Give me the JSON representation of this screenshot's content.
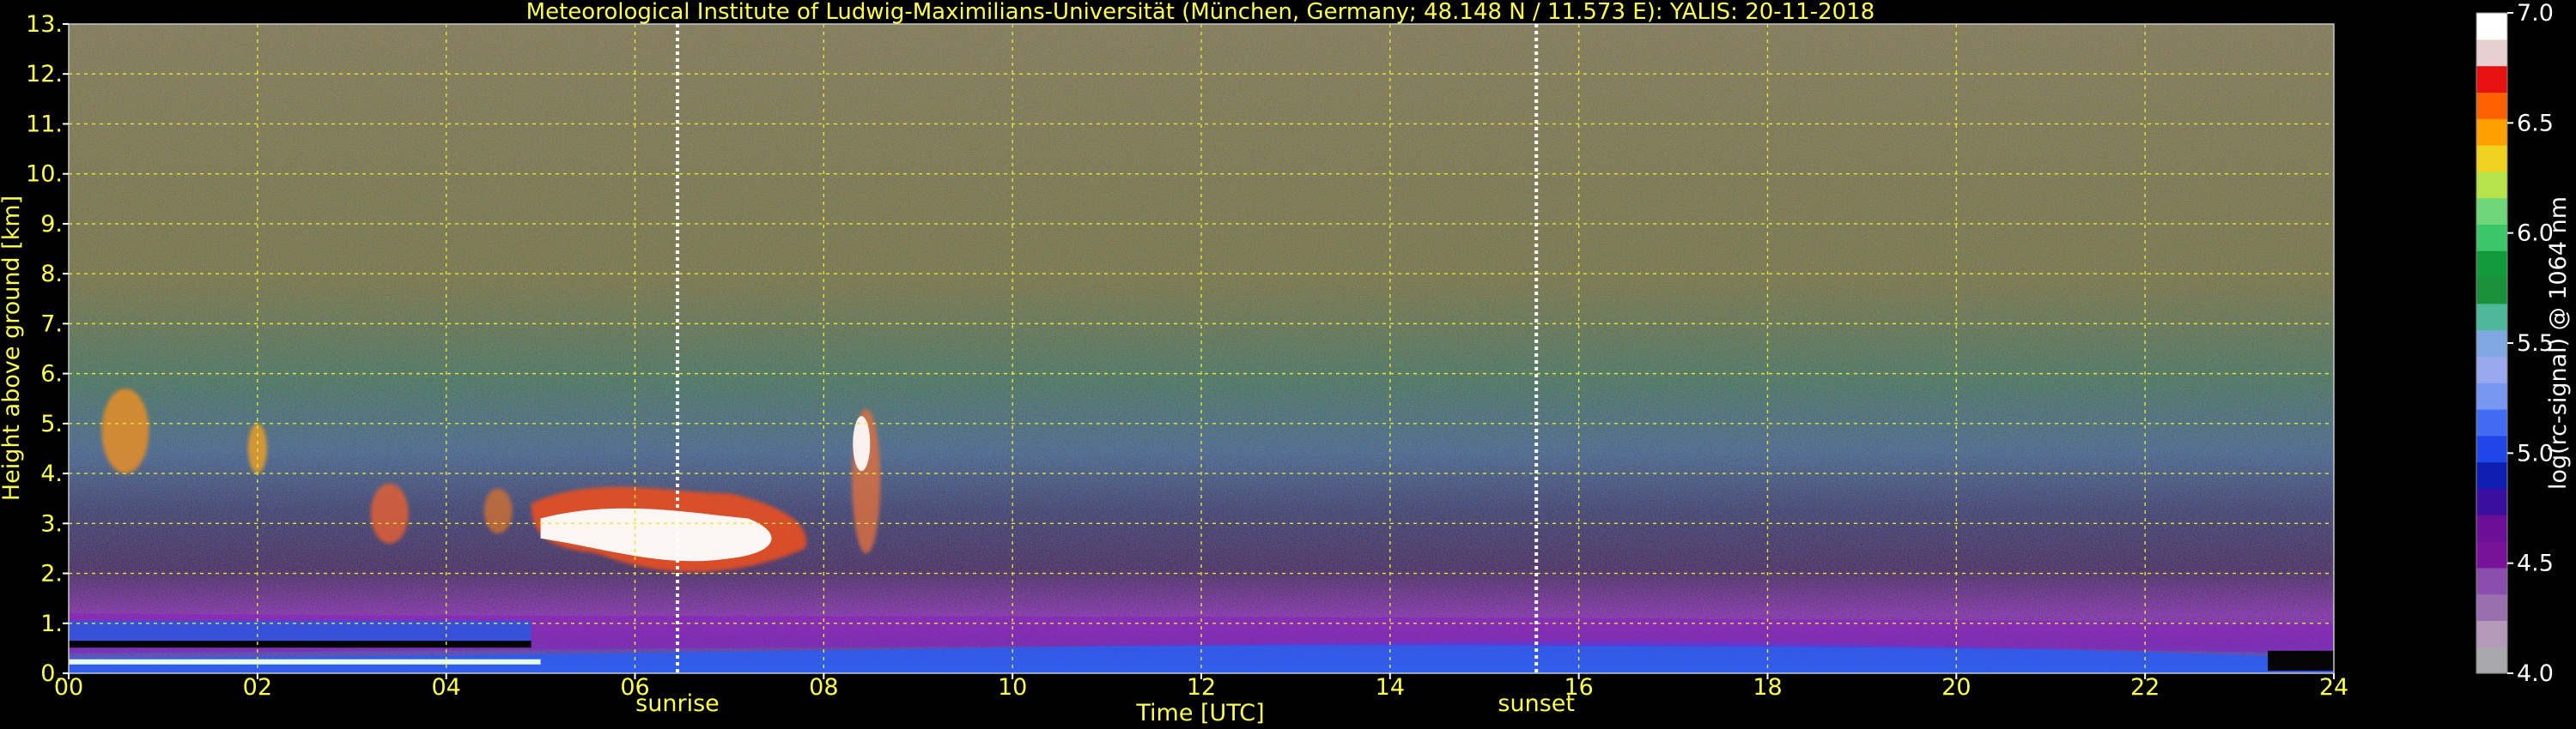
{
  "chart_data": {
    "type": "heatmap",
    "title": "Meteorological Institute of Ludwig-Maximilians-Universität (München, Germany; 48.148 N / 11.573 E):    YALIS: 20-11-2018",
    "xlabel": "Time [UTC]",
    "ylabel": "Height above ground [km]",
    "xlim": [
      0,
      24
    ],
    "ylim": [
      0,
      13
    ],
    "x_ticks": [
      "00",
      "02",
      "04",
      "06",
      "08",
      "10",
      "12",
      "14",
      "16",
      "18",
      "20",
      "22",
      "24"
    ],
    "y_ticks": [
      "0.",
      "1.",
      "2.",
      "3.",
      "4.",
      "5.",
      "6.",
      "7.",
      "8.",
      "9.",
      "10.",
      "11.",
      "12.",
      "13."
    ],
    "grid": true,
    "events": [
      {
        "label": "sunrise",
        "time": 6.45
      },
      {
        "label": "sunset",
        "time": 15.55
      }
    ],
    "colorbar": {
      "label": "log(rc-signal) @ 1064 nm",
      "range": [
        4.0,
        7.0
      ],
      "ticks": [
        "4.0",
        "4.5",
        "5.0",
        "5.5",
        "6.0",
        "6.5",
        "7.0"
      ],
      "colors": [
        "#a9a9ad",
        "#b49ab8",
        "#9a6fb0",
        "#8a4fae",
        "#77129a",
        "#6a0f96",
        "#3a0fa0",
        "#0d1eb0",
        "#1f47e8",
        "#3f6cf0",
        "#7896f2",
        "#9aa8f0",
        "#7fa8e0",
        "#4db89a",
        "#1a8f3c",
        "#129a3a",
        "#3cc56a",
        "#6fd77a",
        "#b6e44a",
        "#f0d020",
        "#ffa000",
        "#ff6000",
        "#e81010",
        "#e8d0d0",
        "#ffffff"
      ]
    },
    "background_colors": {
      "low_signal": "#7a6a3e",
      "aerosol_layer": "#6a2496",
      "boundary_layer": "#2555e8",
      "cloud": "#ffffff"
    }
  }
}
